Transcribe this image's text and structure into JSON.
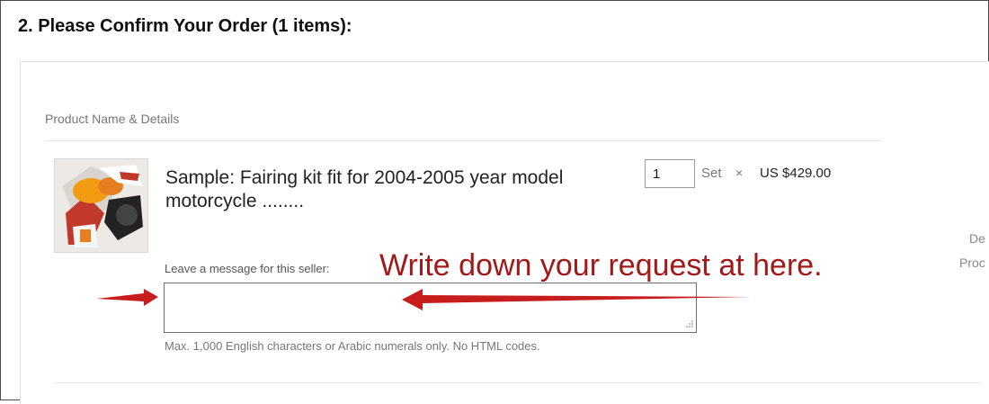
{
  "section": {
    "title": "2. Please Confirm Your Order (1 items):"
  },
  "table": {
    "column_header": "Product Name & Details"
  },
  "item": {
    "name": "Sample: Fairing kit fit for 2004-2005 year model motorcycle ........",
    "quantity": "1",
    "unit": "Set",
    "times_symbol": "×",
    "price": "US $429.00",
    "thumbnail_icon": "motorcycle-fairing-photo"
  },
  "right_column_partial": {
    "line1": "De",
    "line2": "Proc"
  },
  "message": {
    "label": "Leave a message for this seller:",
    "value": "",
    "hint": "Max. 1,000 English characters or Arabic numerals only. No HTML codes."
  },
  "annotation": {
    "text": "Write down your request at here.",
    "color": "#a31818"
  }
}
